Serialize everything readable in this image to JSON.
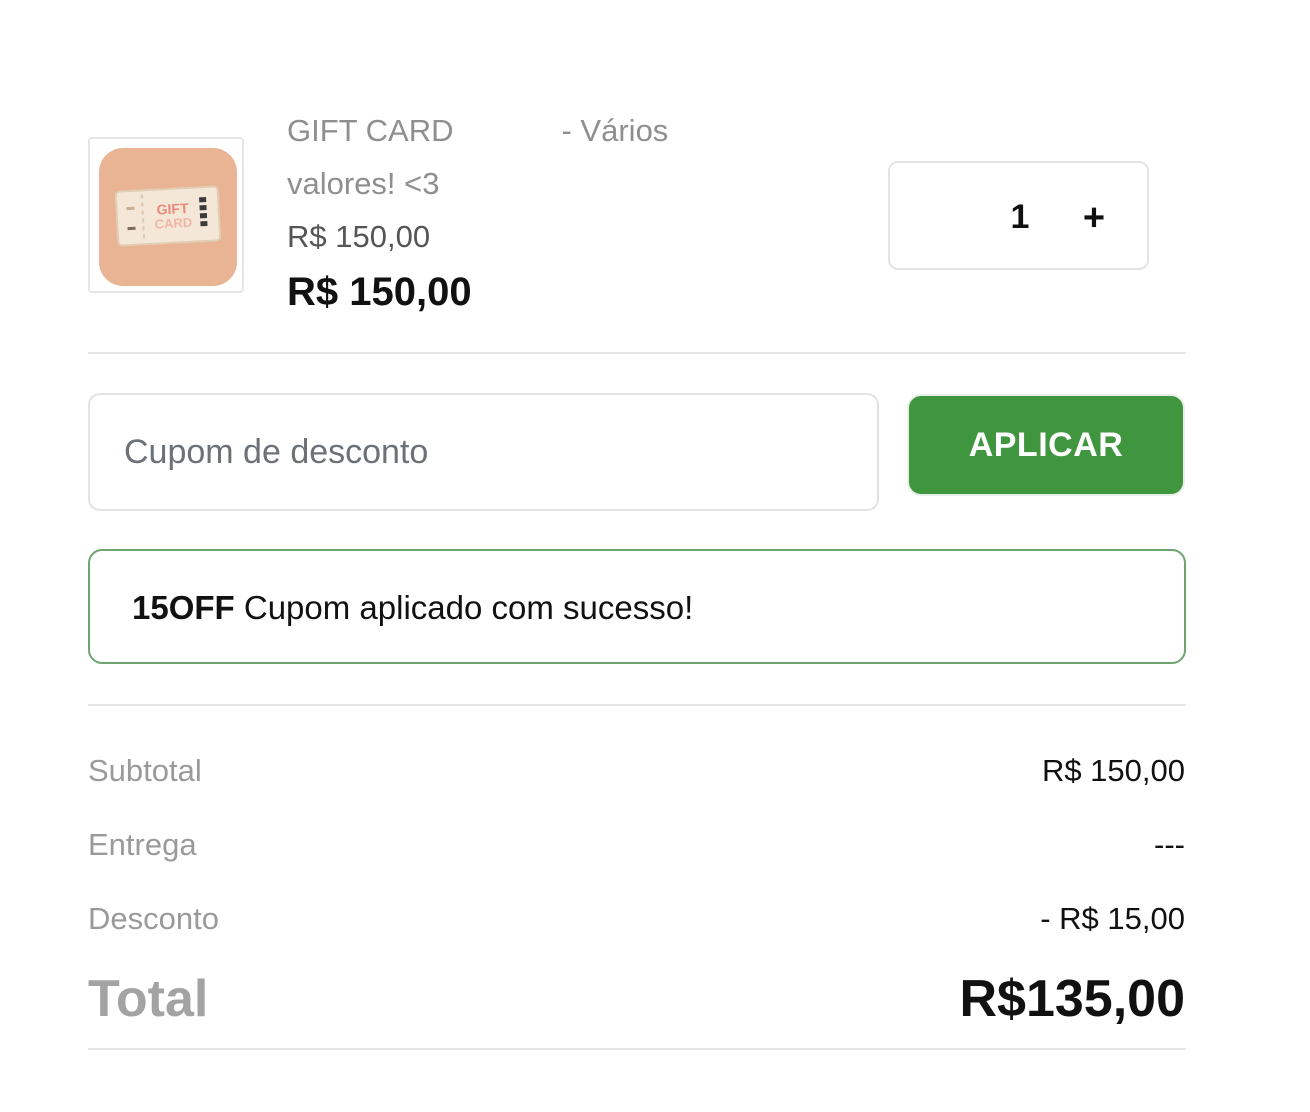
{
  "cart_item": {
    "image_icon": "gift-card-icon",
    "image_text_line1": "GIFT",
    "image_text_line2": "CARD",
    "name": "GIFT CARD",
    "variant": "- Vários",
    "name_line2": "valores! <3",
    "unit_price": "R$ 150,00",
    "line_total": "R$ 150,00",
    "quantity": "1",
    "increment_label": "+"
  },
  "coupon": {
    "placeholder": "Cupom de desconto",
    "value": "",
    "apply_label": "APLICAR",
    "applied_code": "15OFF",
    "success_message": "Cupom aplicado com sucesso!"
  },
  "summary": {
    "subtotal_label": "Subtotal",
    "subtotal_value": "R$ 150,00",
    "shipping_label": "Entrega",
    "shipping_value": "---",
    "discount_label": "Desconto",
    "discount_value": "- R$ 15,00",
    "total_label": "Total",
    "total_value": "R$135,00"
  },
  "colors": {
    "accent_green": "#3f963f",
    "success_border": "#6fa46f",
    "thumbnail_bg": "#e9b493"
  }
}
